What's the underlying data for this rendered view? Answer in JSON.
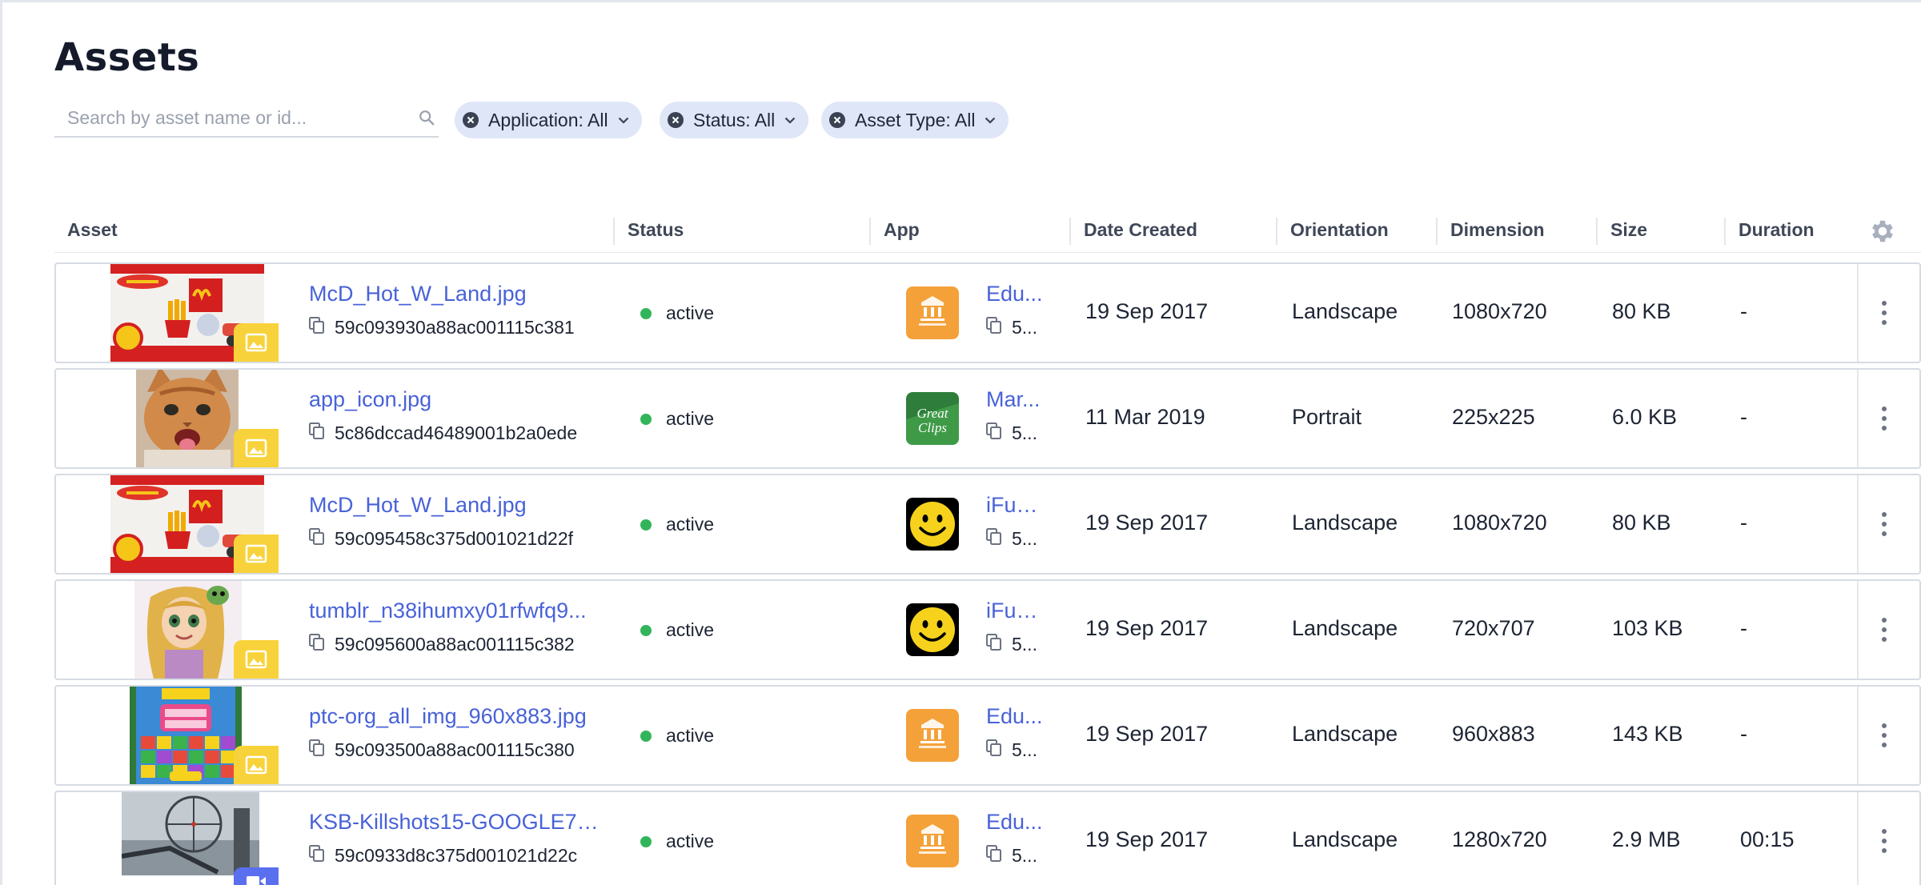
{
  "page": {
    "title": "Assets"
  },
  "search": {
    "placeholder": "Search by asset name or id..."
  },
  "filters": [
    {
      "label": "Application: All"
    },
    {
      "label": "Status: All"
    },
    {
      "label": "Asset Type: All"
    }
  ],
  "table": {
    "headers": {
      "asset": "Asset",
      "status": "Status",
      "app": "App",
      "date_created": "Date Created",
      "orientation": "Orientation",
      "dimension": "Dimension",
      "size": "Size",
      "duration": "Duration"
    },
    "rows": [
      {
        "name": "McD_Hot_W_Land.jpg",
        "id": "59c093930a88ac001115c381",
        "status": "active",
        "app_name": "Edu...",
        "app_id": "5...",
        "app_icon": "education-first-icon",
        "date": "19 Sep 2017",
        "orientation": "Landscape",
        "dimension": "1080x720",
        "size": "80 KB",
        "duration": "-",
        "thumb": "hot-wheels-happy-meal",
        "type": "image"
      },
      {
        "name": "app_icon.jpg",
        "id": "5c86dccad46489001b2a0ede",
        "status": "active",
        "app_name": "Mar...",
        "app_id": "5...",
        "app_icon": "great-clips-icon",
        "date": "11 Mar 2019",
        "orientation": "Portrait",
        "dimension": "225x225",
        "size": "6.0 KB",
        "duration": "-",
        "thumb": "kitten",
        "type": "image"
      },
      {
        "name": "McD_Hot_W_Land.jpg",
        "id": "59c095458c375d001021d22f",
        "status": "active",
        "app_name": "iFun...",
        "app_id": "5...",
        "app_icon": "smiley-icon",
        "date": "19 Sep 2017",
        "orientation": "Landscape",
        "dimension": "1080x720",
        "size": "80 KB",
        "duration": "-",
        "thumb": "hot-wheels-happy-meal",
        "type": "image"
      },
      {
        "name": "tumblr_n38ihumxy01rfwfq9...",
        "id": "59c095600a88ac001115c382",
        "status": "active",
        "app_name": "iFun...",
        "app_id": "5...",
        "app_icon": "smiley-icon",
        "date": "19 Sep 2017",
        "orientation": "Landscape",
        "dimension": "720x707",
        "size": "103 KB",
        "duration": "-",
        "thumb": "rapunzel",
        "type": "image"
      },
      {
        "name": "ptc-org_all_img_960x883.jpg",
        "id": "59c093500a88ac001115c380",
        "status": "active",
        "app_name": "Edu...",
        "app_id": "5...",
        "app_icon": "education-first-icon",
        "date": "19 Sep 2017",
        "orientation": "Landscape",
        "dimension": "960x883",
        "size": "143 KB",
        "duration": "-",
        "thumb": "toon-blast",
        "type": "image"
      },
      {
        "name": "KSB-Killshots15-GOOGLE72...",
        "id": "59c0933d8c375d001021d22c",
        "status": "active",
        "app_name": "Edu...",
        "app_id": "5...",
        "app_icon": "education-first-icon",
        "date": "19 Sep 2017",
        "orientation": "Landscape",
        "dimension": "1280x720",
        "size": "2.9 MB",
        "duration": "00:15",
        "thumb": "sniper-scope",
        "type": "video"
      }
    ]
  },
  "colors": {
    "link": "#4862d8",
    "chip_bg": "#dfe6f8",
    "status_active": "#32b55a",
    "badge_image": "#f8d23a",
    "badge_video": "#5a6ff0"
  }
}
